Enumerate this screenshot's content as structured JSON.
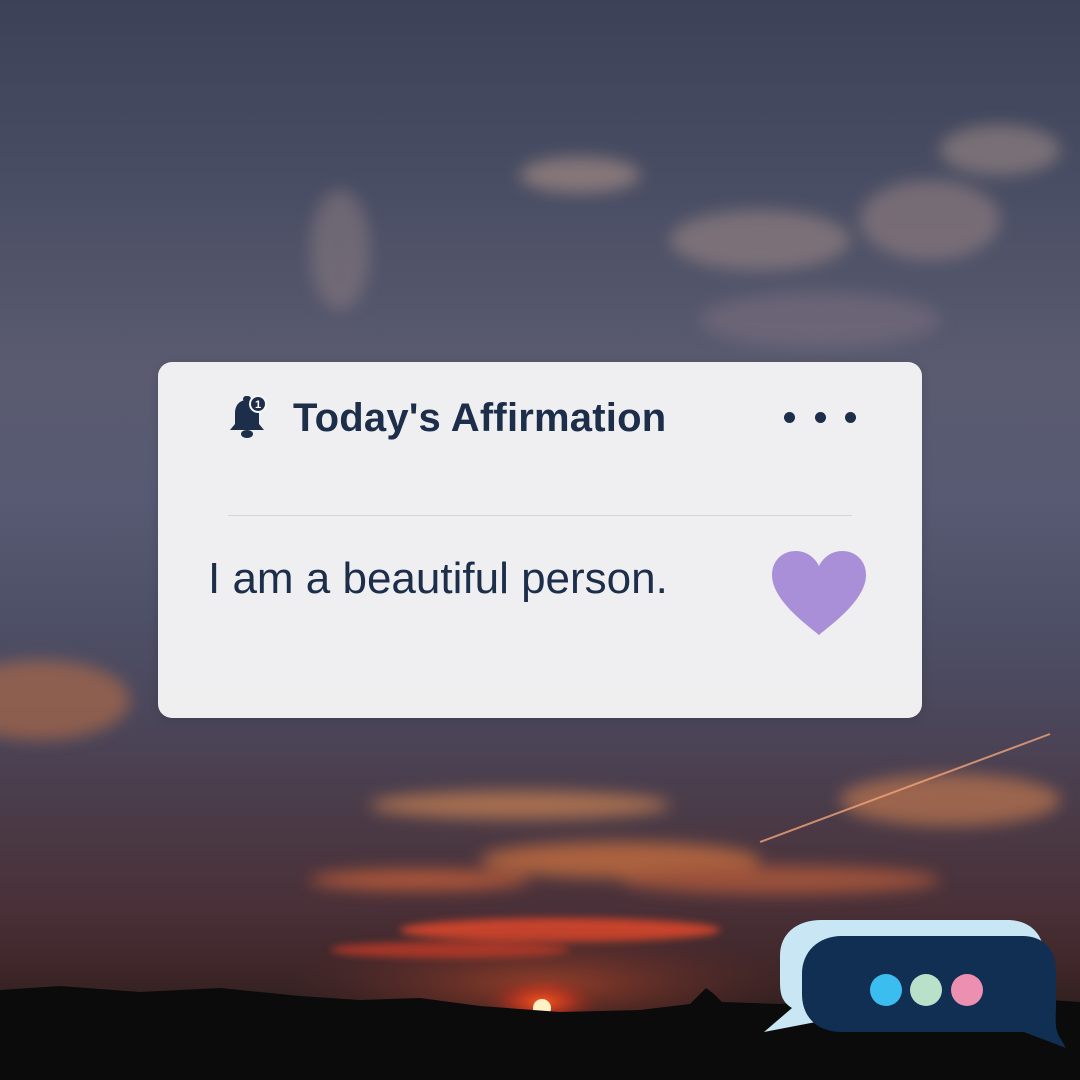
{
  "notification": {
    "icon": "bell-icon",
    "badge_count": "1",
    "title": "Today's Affirmation",
    "more_icon": "more-options-icon",
    "message": "I am a beautiful person.",
    "heart_icon": "heart-icon"
  },
  "chat_widget": {
    "icon": "chat-bubble-icon",
    "dot_colors": [
      "#3cbdf0",
      "#b9e0c9",
      "#ec8fb0"
    ]
  },
  "colors": {
    "text": "#1c2e4a",
    "heart": "#a98fd8",
    "card": "#f6f6f7",
    "bubble_back": "#c8e6f4",
    "bubble_front": "#102f52"
  }
}
